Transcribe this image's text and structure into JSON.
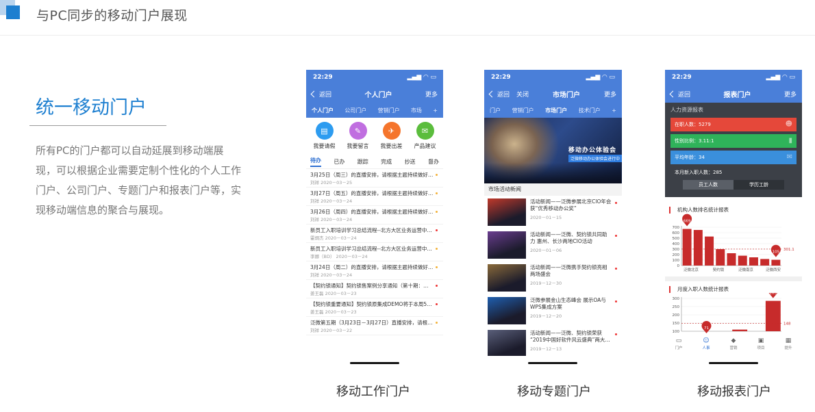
{
  "header": {
    "title": "与PC同步的移动门户展现"
  },
  "intro": {
    "title": "统一移动门户",
    "lines": [
      "所有PC的门户都可以自动延展到移动端展",
      "现，可以根据企业需要定制个性化的个人工作",
      "门户、公司门户、专题门户和报表门户等，实",
      "现移动端信息的聚合与展现。"
    ]
  },
  "phone1": {
    "time": "22:29",
    "back": "返回",
    "title": "个人门户",
    "more": "更多",
    "tabs": [
      "个人门户",
      "公司门户",
      "营销门户",
      "市场",
      "+"
    ],
    "quick": [
      {
        "label": "我要请假",
        "icon": "document-icon",
        "glyph": "▤",
        "color": "#2d9cf0"
      },
      {
        "label": "我要留言",
        "icon": "chat-icon",
        "glyph": "✎",
        "color": "#c06ee0"
      },
      {
        "label": "我要出差",
        "icon": "airplane-icon",
        "glyph": "✈",
        "color": "#f5752c"
      },
      {
        "label": "产品建议",
        "icon": "feedback-icon",
        "glyph": "✉",
        "color": "#5bbd3d"
      }
    ],
    "subtabs": [
      "待办",
      "已办",
      "跟踪",
      "完成",
      "抄送",
      "督办"
    ],
    "todos": [
      {
        "title": "3月25日（周三）的直播安排，请根据主题持续做好…",
        "meta": "刘祥  2020－03－25",
        "dot": "#f3b23a"
      },
      {
        "title": "3月27日（周五）的直播安排，请根据主题持续做好…",
        "meta": "刘祥  2020－03－24",
        "dot": "#f3b23a"
      },
      {
        "title": "3月26日（周四）的直播安排，请根据主题持续做好…",
        "meta": "刘祥  2020－03－24",
        "dot": "#f3b23a"
      },
      {
        "title": "新员工入职培训学习总结流程--北方大区业务运营中…",
        "meta": "霍炯杰  2020－03－24",
        "dot": "#e33"
      },
      {
        "title": "新员工入职培训学习总结流程--北方大区业务运营中…",
        "meta": "李娜（BD）  2020－03－24",
        "dot": "#f3b23a"
      },
      {
        "title": "3月24日（周二）的直播安排，请根据主题持续做好…",
        "meta": "刘祥  2020－03－24",
        "dot": "#f3b23a"
      },
      {
        "title": "【契约锁通知】契约锁售案例分享通知（第十期：…",
        "meta": "姜王磊  2020－03－23",
        "dot": "#e33"
      },
      {
        "title": "【契约锁重要通知】契约锁原集成DEMO将于本周5…",
        "meta": "姜王磊  2020－03－23",
        "dot": "#e33"
      },
      {
        "title": "泛微第五期（3月23日－3月27日）直播安排，请根…",
        "meta": "刘祥  2020－03－22",
        "dot": "#f3b23a"
      }
    ],
    "caption": "移动工作门户"
  },
  "phone2": {
    "time": "22:29",
    "back": "返回",
    "close": "关闭",
    "title": "市场门户",
    "more": "更多",
    "tabs": [
      "门户",
      "营销门户",
      "市场门户",
      "技术门户",
      "+"
    ],
    "banner_title": "移动办公体验会",
    "banner_sub": "泛微移动办公体验会进行中",
    "section": "市场活动新闻",
    "news": [
      {
        "title": "活动新闻——泛微参展北京CIO年会 获“优秀移动办公奖”",
        "date": "2020－01－15",
        "img": "#c0392b"
      },
      {
        "title": "活动新闻——泛微、契约锁共同助力 惠州、长沙两地CIO活动",
        "date": "2020－01－06",
        "img": "#6a3d8f"
      },
      {
        "title": "活动新闻——泛微携手契约锁亮相两场盛会",
        "date": "2019－12－30",
        "img": "#8a6a3a"
      },
      {
        "title": "泛微参展金山生态峰会 展示OA与WPS集成方案",
        "date": "2019－12－20",
        "img": "#1f5fb0"
      },
      {
        "title": "活动新闻——泛微、契约锁荣获 “2019中国好软件风云盛典”两大…",
        "date": "2019－12－13",
        "img": "#5a5f7a"
      }
    ],
    "caption": "移动专题门户"
  },
  "phone3": {
    "time": "22:29",
    "back": "返回",
    "title": "报表门户",
    "more": "更多",
    "hr_header": "人力资源报表",
    "stats": [
      {
        "label": "在职人数：5279",
        "color": "#e5483a",
        "icon": "people-icon",
        "glyph": "☻"
      },
      {
        "label": "性别比例：3.11:1",
        "color": "#2fb35a",
        "icon": "signal-icon",
        "glyph": "▮"
      },
      {
        "label": "平均年龄：34",
        "color": "#3a8fdc",
        "icon": "mail-icon",
        "glyph": "✉"
      }
    ],
    "new_hire": "本月新入职人数：285",
    "toggle": [
      "员工人数",
      "学历工龄"
    ],
    "tabbar": [
      {
        "label": "门户",
        "icon": "monitor-icon",
        "glyph": "▭"
      },
      {
        "label": "人事",
        "icon": "users-icon",
        "glyph": "☺"
      },
      {
        "label": "营销",
        "icon": "tag-icon",
        "glyph": "◆"
      },
      {
        "label": "项目",
        "icon": "folder-icon",
        "glyph": "▣"
      },
      {
        "label": "提升",
        "icon": "briefcase-icon",
        "glyph": "▦"
      }
    ],
    "caption": "移动报表门户"
  },
  "chart_data": [
    {
      "type": "bar",
      "title": "机构人数排名统计报表",
      "categories": [
        "泛微北京",
        "",
        "契约锁",
        "",
        "泛微南京",
        "",
        "泛微西安"
      ],
      "values": [
        669,
        650,
        530,
        300,
        225,
        180,
        150,
        120,
        105
      ],
      "y_ticks": [
        0,
        100,
        200,
        300,
        400,
        500,
        600,
        700
      ],
      "ylim": [
        0,
        700
      ],
      "annotations": {
        "max": 669,
        "min": 105,
        "avg_label": "301.1",
        "avg": 301.1
      },
      "color": "#c72b2b"
    },
    {
      "type": "bar",
      "title": "月度入职人数统计报表",
      "values": [
        100,
        71,
        0,
        110,
        0,
        285
      ],
      "y_ticks": [
        100,
        150,
        200,
        250,
        300
      ],
      "ylim": [
        100,
        300
      ],
      "annotations": {
        "max": 285,
        "min": 71,
        "avg_label": "148",
        "avg": 148
      },
      "color": "#c72b2b"
    }
  ]
}
